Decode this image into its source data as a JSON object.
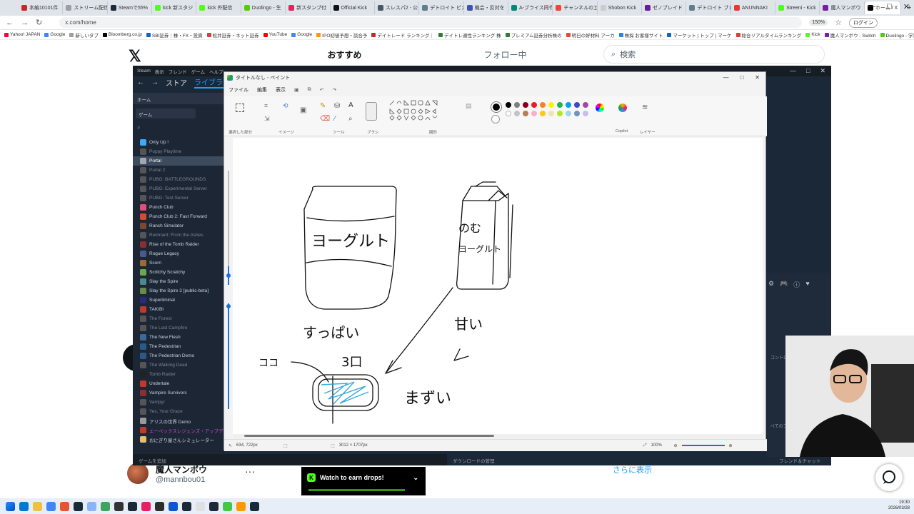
{
  "browser": {
    "tabs": [
      {
        "label": "本編10101件",
        "color": "#c62828"
      },
      {
        "label": "ストリーム配信",
        "color": "#9e9e9e"
      },
      {
        "label": "Steamで55%",
        "color": "#1b2838"
      },
      {
        "label": "kick 新スタジ",
        "color": "#53fc18"
      },
      {
        "label": "kick 外配信",
        "color": "#53fc18"
      },
      {
        "label": "Duolingo - 生",
        "color": "#58cc02"
      },
      {
        "label": "新スタンプ付",
        "color": "#e91e63"
      },
      {
        "label": "Official Kick",
        "color": "#111111"
      },
      {
        "label": "スレスパ2 - 公",
        "color": "#455a64"
      },
      {
        "label": "デトロイト ビカム",
        "color": "#607d8b"
      },
      {
        "label": "機会・反対を",
        "color": "#3f51b5"
      },
      {
        "label": "A-ブライス同作",
        "color": "#00897b"
      },
      {
        "label": "チャンネルの工",
        "color": "#f44336"
      },
      {
        "label": "Shobon Kick",
        "color": "#cccccc"
      },
      {
        "label": "ゼノブレイド",
        "color": "#6a1b9a"
      },
      {
        "label": "デトロイト ブレイ",
        "color": "#607d8b"
      },
      {
        "label": "ANUNNAKI",
        "color": "#e53935"
      },
      {
        "label": "Streeni - Kick",
        "color": "#53fc18"
      },
      {
        "label": "魔人マンボウ",
        "color": "#7b1fa2"
      },
      {
        "label": "ホーム / X",
        "color": "#000000"
      }
    ],
    "new_tab": "+",
    "window_controls": [
      "—",
      "□",
      "✕"
    ],
    "url": "x.com/home",
    "zoom": "150%",
    "login_label": "ログイン",
    "bookmarks": [
      {
        "label": "Yahoo! JAPAN",
        "color": "#ff0033"
      },
      {
        "label": "Google",
        "color": "#4285f4"
      },
      {
        "label": "新しいタブ",
        "color": "#9e9e9e"
      },
      {
        "label": "Bloomberg.co.jp",
        "color": "#000000"
      },
      {
        "label": "SBI証券｜株・FX・投資",
        "color": "#1565c0"
      },
      {
        "label": "松井証券・ネット証券",
        "color": "#e53935"
      },
      {
        "label": "YouTube",
        "color": "#ff0000"
      },
      {
        "label": "Google",
        "color": "#4285f4"
      },
      {
        "label": "IPO初値予想・談合予",
        "color": "#ff9800"
      },
      {
        "label": "デイトレード ランキング｜",
        "color": "#c62828"
      },
      {
        "label": "デイトレ適性ランキング 株",
        "color": "#2e7d32"
      },
      {
        "label": "プレミアム証券分析株の",
        "color": "#2e7d32"
      },
      {
        "label": "明日の好材料 アーカ",
        "color": "#f44336"
      },
      {
        "label": "株探 お客様サイト",
        "color": "#1e88e5"
      },
      {
        "label": "マーケット | トップ | マーケ",
        "color": "#1565c0"
      },
      {
        "label": "総合リアルタイムランキング",
        "color": "#e53935"
      },
      {
        "label": "Kick",
        "color": "#53fc18"
      },
      {
        "label": "魔人マンボウ - Switch",
        "color": "#7b1fa2"
      },
      {
        "label": "Duolingo - 学習効果が",
        "color": "#58cc02"
      }
    ]
  },
  "x": {
    "logo": "𝕏",
    "tab_recommended": "おすすめ",
    "tab_following": "フォロー中",
    "search_placeholder": "検索",
    "profile_name": "魔人マンボウ",
    "profile_handle": "@mannbou01",
    "more": "···",
    "show_more": "さらに表示"
  },
  "steam": {
    "menu": [
      "Steam",
      "表示",
      "フレンド",
      "ゲーム",
      "ヘルプ"
    ],
    "nav_store": "ストア",
    "nav_library": "ライブラリ",
    "home": "ホーム",
    "games_dropdown": "ゲーム",
    "controller_text": "コントローラ設定を表示",
    "friends_text": "べてのフレンドを表示",
    "add_game": "ゲームを追加",
    "download_manager": "ダウンロードの管理",
    "friends_chat": "フレンド＆チャット",
    "games": [
      {
        "name": "Only Up !",
        "color": "#3fa9f5",
        "style": "normal"
      },
      {
        "name": "Poppy Playtime",
        "color": "#555555",
        "style": "dim"
      },
      {
        "name": "Portal",
        "color": "#a0a8b0",
        "style": "sel"
      },
      {
        "name": "Portal 2",
        "color": "#555555",
        "style": "dim"
      },
      {
        "name": "PUBG: BATTLEGROUNDS",
        "color": "#555555",
        "style": "dim"
      },
      {
        "name": "PUBG: Experimental Server",
        "color": "#555555",
        "style": "dim"
      },
      {
        "name": "PUBG: Test Server",
        "color": "#555555",
        "style": "dim"
      },
      {
        "name": "Punch Club",
        "color": "#e04f7a",
        "style": "normal"
      },
      {
        "name": "Punch Club 2: Fast Forward",
        "color": "#d84a2f",
        "style": "normal"
      },
      {
        "name": "Ranch Simulator",
        "color": "#7a4a2f",
        "style": "normal"
      },
      {
        "name": "Remnant: From the Ashes",
        "color": "#555555",
        "style": "dim"
      },
      {
        "name": "Rise of the Tomb Raider",
        "color": "#8a2f2f",
        "style": "normal"
      },
      {
        "name": "Rogue Legacy",
        "color": "#4a5a8a",
        "style": "normal"
      },
      {
        "name": "Scorn",
        "color": "#9a6a3a",
        "style": "normal"
      },
      {
        "name": "Scritchy Scratchy",
        "color": "#6aa84f",
        "style": "normal"
      },
      {
        "name": "Slay the Spire",
        "color": "#4a8a8a",
        "style": "normal"
      },
      {
        "name": "Slay the Spire 2 [public-beta]",
        "color": "#6a8a4a",
        "style": "normal"
      },
      {
        "name": "Superliminal",
        "color": "#2a2a7a",
        "style": "normal"
      },
      {
        "name": "TAKIBI",
        "color": "#c0392b",
        "style": "normal"
      },
      {
        "name": "The Forest",
        "color": "#555555",
        "style": "dim"
      },
      {
        "name": "The Last Campfire",
        "color": "#555555",
        "style": "dim"
      },
      {
        "name": "The New Flesh",
        "color": "#3a6a9a",
        "style": "normal"
      },
      {
        "name": "The Pedestrian",
        "color": "#2a5a8a",
        "style": "normal"
      },
      {
        "name": "The Pedestrian Demo",
        "color": "#2a5a8a",
        "style": "normal"
      },
      {
        "name": "The Walking Dead",
        "color": "#555555",
        "style": "dim"
      },
      {
        "name": "Tomb Raider",
        "color": "#222222",
        "style": "dim"
      },
      {
        "name": "Undertale",
        "color": "#c0392b",
        "style": "normal"
      },
      {
        "name": "Vampire Survivors",
        "color": "#8a2f2f",
        "style": "normal"
      },
      {
        "name": "Vampyr",
        "color": "#555555",
        "style": "dim"
      },
      {
        "name": "Yes, Your Grace",
        "color": "#555555",
        "style": "dim"
      },
      {
        "name": "アリスの世界 Demo",
        "color": "#9a9a9a",
        "style": "normal"
      },
      {
        "name": "エーペックスレジェンズ・アップデ",
        "color": "#c0392b",
        "style": "hl"
      },
      {
        "name": "おにぎり屋さんシミュレーター",
        "color": "#e0c070",
        "style": "normal"
      }
    ]
  },
  "paint": {
    "title": "タイトルなし - ペイント",
    "menu": [
      "ファイル",
      "編集",
      "表示"
    ],
    "groups": [
      "選択した部分",
      "イメージ",
      "ツール",
      "ブラシ",
      "図形",
      "",
      "Copilot",
      "レイヤー"
    ],
    "colors": [
      "#000000",
      "#7f7f7f",
      "#880015",
      "#ed1c24",
      "#ff7f27",
      "#fff200",
      "#22b14c",
      "#00a2e8",
      "#3f48cc",
      "#a349a4"
    ],
    "colors_row2": [
      "#ffffff",
      "#c3c3c3",
      "#b97a57",
      "#ffaec9",
      "#ffc90e",
      "#efe4b0",
      "#b5e61d",
      "#99d9ea",
      "#7092be",
      "#c8bfe7"
    ],
    "status_pos": "634, 722px",
    "status_size": "3012 × 1707px",
    "zoom": "100%",
    "drawing_text": {
      "yogurt": "ヨーグルト",
      "milk_a": "のむ",
      "milk_b": "ヨーグルト",
      "sour": "すっぱい",
      "sweet": "甘い",
      "koko": "ココ",
      "num": "3口",
      "mazui": "まずい"
    }
  },
  "drops": {
    "label": "Watch to earn drops!",
    "badge": "K",
    "progress": 0.9
  },
  "taskbar": {
    "icons": [
      "#0078d4",
      "#f0c040",
      "#4285f4",
      "#e8542f",
      "#1b2838",
      "#8ab4f8",
      "#3ba55c",
      "#333333",
      "#1b2838",
      "#e91e63",
      "#2d2d2d",
      "#0b57d0",
      "#1b2838",
      "#e0e0e0",
      "#1b2838",
      "#45c945",
      "#ff9800",
      "#1b2838"
    ],
    "time": "19:30",
    "date": "2026/03/28"
  }
}
